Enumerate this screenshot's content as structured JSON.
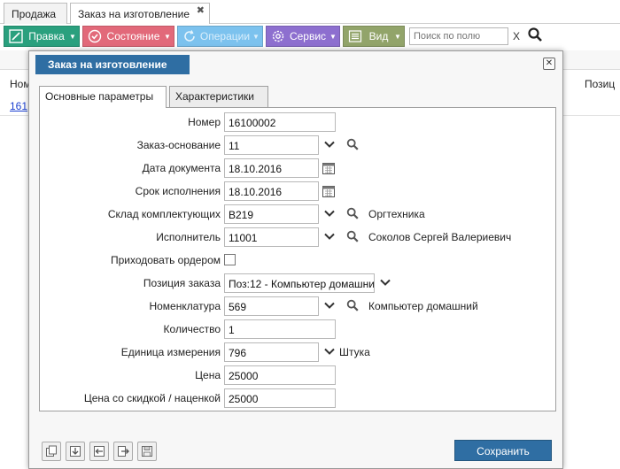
{
  "tabs": [
    {
      "label": "Продажа"
    },
    {
      "label": "Заказ на изготовление",
      "close": "✖"
    }
  ],
  "toolbar": {
    "edit_label": "Правка",
    "state_label": "Состояние",
    "ops_label": "Операции",
    "service_label": "Сервис",
    "view_label": "Вид",
    "search_placeholder": "Поиск по полю",
    "clear_label": "X",
    "colors": {
      "edit": "#2aa07e",
      "state": "#e2697a",
      "ops": "#7cc2ee",
      "service": "#8d6fcf",
      "view": "#92a46a"
    }
  },
  "background": {
    "col1_header": "Ном",
    "col2_header": "Позиц",
    "first_cell": "161"
  },
  "dialog": {
    "title": "Заказ на изготовление",
    "close_label": "✕",
    "tabs": [
      {
        "label": "Основные параметры"
      },
      {
        "label": "Характеристики"
      }
    ],
    "fields": {
      "number": {
        "label": "Номер",
        "value": "16100002"
      },
      "base_order": {
        "label": "Заказ-основание",
        "value": "11"
      },
      "doc_date": {
        "label": "Дата документа",
        "value": "18.10.2016"
      },
      "due_date": {
        "label": "Срок исполнения",
        "value": "18.10.2016"
      },
      "warehouse": {
        "label": "Склад комплектующих",
        "value": "В219",
        "extra": "Оргтехника"
      },
      "executor": {
        "label": "Исполнитель",
        "value": "11001",
        "extra": "Соколов Сергей Валериевич"
      },
      "receive_by_order": {
        "label": "Приходовать ордером",
        "checked": false
      },
      "order_position": {
        "label": "Позиция заказа",
        "value": "Поз:12 - Компьютер домашни"
      },
      "nomenclature": {
        "label": "Номенклатура",
        "value": "569",
        "extra": "Компьютер домашний"
      },
      "quantity": {
        "label": "Количество",
        "value": "1"
      },
      "unit": {
        "label": "Единица измерения",
        "value": "796",
        "extra": "Штука"
      },
      "price": {
        "label": "Цена",
        "value": "25000"
      },
      "price_discount": {
        "label": "Цена со скидкой / наценкой",
        "value": "25000"
      }
    },
    "save_label": "Сохранить",
    "footer_icons": [
      "copy-icon",
      "import-icon",
      "back-icon",
      "export-icon",
      "save-disk-icon"
    ],
    "accent": "#2f6ea3"
  }
}
